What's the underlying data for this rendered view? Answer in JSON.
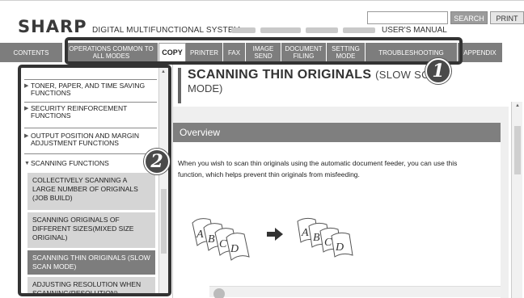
{
  "header": {
    "brand": "SHARP",
    "system_title": "DIGITAL MULTIFUNCTIONAL SYSTEM",
    "manual_title": "USER'S MANUAL",
    "search_label": "SEARCH",
    "print_label": "PRINT",
    "search_placeholder": ""
  },
  "tabs": [
    {
      "label": "CONTENTS",
      "active": false
    },
    {
      "label": "OPERATIONS COMMON TO ALL MODES",
      "active": false
    },
    {
      "label": "COPY",
      "active": true
    },
    {
      "label": "PRINTER",
      "active": false
    },
    {
      "label": "FAX",
      "active": false
    },
    {
      "label": "IMAGE SEND",
      "active": false
    },
    {
      "label": "DOCUMENT FILING",
      "active": false
    },
    {
      "label": "SETTING MODE",
      "active": false
    },
    {
      "label": "TROUBLESHOOTING",
      "active": false
    },
    {
      "label": "APPENDIX",
      "active": false
    }
  ],
  "sidebar": {
    "items": [
      {
        "label": "TONER, PAPER, AND TIME SAVING FUNCTIONS",
        "expanded": false
      },
      {
        "label": "SECURITY REINFORCEMENT FUNCTIONS",
        "expanded": false
      },
      {
        "label": "OUTPUT POSITION AND MARGIN ADJUSTMENT FUNCTIONS",
        "expanded": false
      },
      {
        "label": "SCANNING FUNCTIONS",
        "expanded": true
      }
    ],
    "subitems": [
      {
        "label": "COLLECTIVELY SCANNING A LARGE NUMBER OF ORIGINALS (JOB BUILD)",
        "active": false
      },
      {
        "label": "SCANNING ORIGINALS OF DIFFERENT SIZES(MIXED SIZE ORIGINAL)",
        "active": false
      },
      {
        "label": "SCANNING THIN ORIGINALS (SLOW SCAN MODE)",
        "active": true
      },
      {
        "label": "ADJUSTING RESOLUTION WHEN SCANNING(RESOLUTION)",
        "active": false
      }
    ]
  },
  "content": {
    "title_main": "SCANNING THIN ORIGINALS",
    "title_sub": "(SLOW SC",
    "title_cont": "MODE)",
    "section_heading": "Overview",
    "paragraph": "When you wish to scan thin originals using the automatic document feeder, you can use this function, which helps prevent thin originals from misfeeding."
  },
  "illustration": {
    "letters": [
      "A",
      "B",
      "C",
      "D"
    ]
  },
  "badges": [
    "1",
    "2"
  ],
  "colors": {
    "tab_bg": "#7d7d7d",
    "active_sub_bg": "#7d7d7d",
    "sub_bg": "#d5d5d5",
    "overview_bar": "#7f7f7f",
    "badge": "#4a4a4a"
  }
}
